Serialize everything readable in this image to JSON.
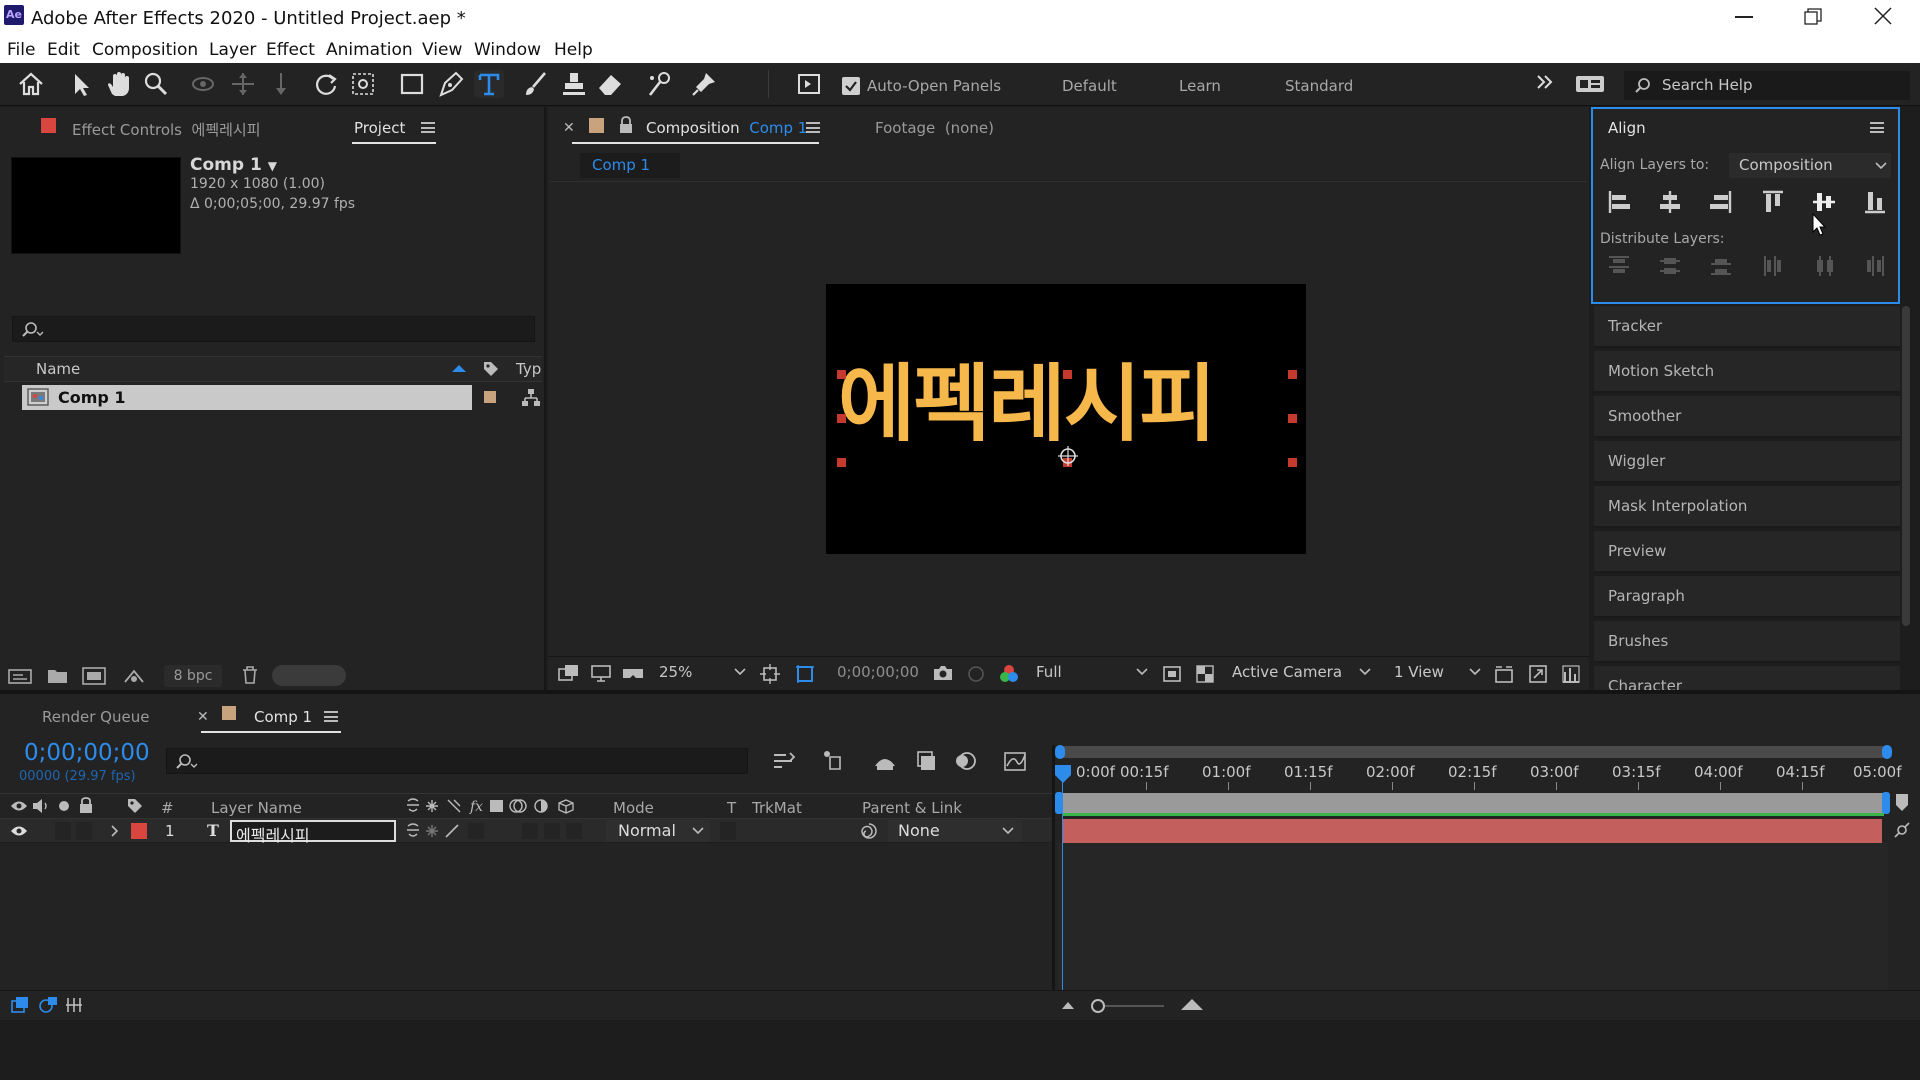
{
  "app": {
    "title": "Adobe After Effects 2020 - Untitled Project.aep *",
    "logo_text": "Ae",
    "window_controls": [
      "minimize-icon",
      "restore-icon",
      "close-icon"
    ]
  },
  "menu": [
    "File",
    "Edit",
    "Composition",
    "Layer",
    "Effect",
    "Animation",
    "View",
    "Window",
    "Help"
  ],
  "toolbar": {
    "auto_open_label": "Auto-Open Panels",
    "auto_open_checked": true,
    "workspaces": [
      "Default",
      "Learn",
      "Standard"
    ],
    "search_placeholder": "Search Help"
  },
  "project_panel": {
    "effect_controls_tab": "Effect Controls",
    "effect_controls_target": "에펙레시피",
    "project_tab": "Project",
    "comp_name": "Comp 1",
    "comp_size": "1920 x 1080 (1.00)",
    "comp_duration": "Δ 0;00;05;00, 29.97 fps",
    "col_name": "Name",
    "col_type": "Typ",
    "items": [
      {
        "name": "Comp 1"
      }
    ],
    "bpc": "8 bpc"
  },
  "composition_panel": {
    "tab_prefix": "Composition",
    "tab_comp": "Comp 1",
    "footage_tab": "Footage",
    "footage_value": "(none)",
    "breadcrumb": "Comp 1",
    "canvas_text": "에펙레시피",
    "canvas_text_color": "#f7b84b",
    "zoom": "25%",
    "timecode": "0;00;00;00",
    "resolution": "Full",
    "camera": "Active Camera",
    "views": "1 View"
  },
  "align_panel": {
    "title": "Align",
    "align_to_label": "Align Layers to:",
    "align_to_value": "Composition",
    "distribute_label": "Distribute Layers:",
    "align_buttons": [
      "align-left-icon",
      "align-hcenter-icon",
      "align-right-icon",
      "align-top-icon",
      "align-vcenter-icon",
      "align-bottom-icon"
    ],
    "distribute_buttons": [
      "distribute-top-icon",
      "distribute-vcenter-icon",
      "distribute-bottom-icon",
      "distribute-left-icon",
      "distribute-hcenter-icon",
      "distribute-right-icon"
    ]
  },
  "side_panels": [
    "Tracker",
    "Motion Sketch",
    "Smoother",
    "Wiggler",
    "Mask Interpolation",
    "Preview",
    "Paragraph",
    "Brushes",
    "Character"
  ],
  "timeline": {
    "render_queue_tab": "Render Queue",
    "comp_tab": "Comp 1",
    "timecode": "0;00;00;00",
    "frame_info": "00000 (29.97 fps)",
    "columns": {
      "number": "#",
      "layer_name": "Layer Name",
      "mode": "Mode",
      "t": "T",
      "trkmat": "TrkMat",
      "parent": "Parent & Link"
    },
    "ruler_labels": [
      "0:00f",
      "00:15f",
      "01:00f",
      "01:15f",
      "02:00f",
      "02:15f",
      "03:00f",
      "03:15f",
      "04:00f",
      "04:15f",
      "05:00f"
    ],
    "layers": [
      {
        "index": "1",
        "type_icon": "T",
        "name": "에펙레시피",
        "mode": "Normal",
        "parent": "None",
        "label_color": "#d9463f"
      }
    ]
  },
  "colors": {
    "accent": "#2d8ceb",
    "layer_bar": "#c35f5c",
    "comp_label": "#c9a27e"
  }
}
